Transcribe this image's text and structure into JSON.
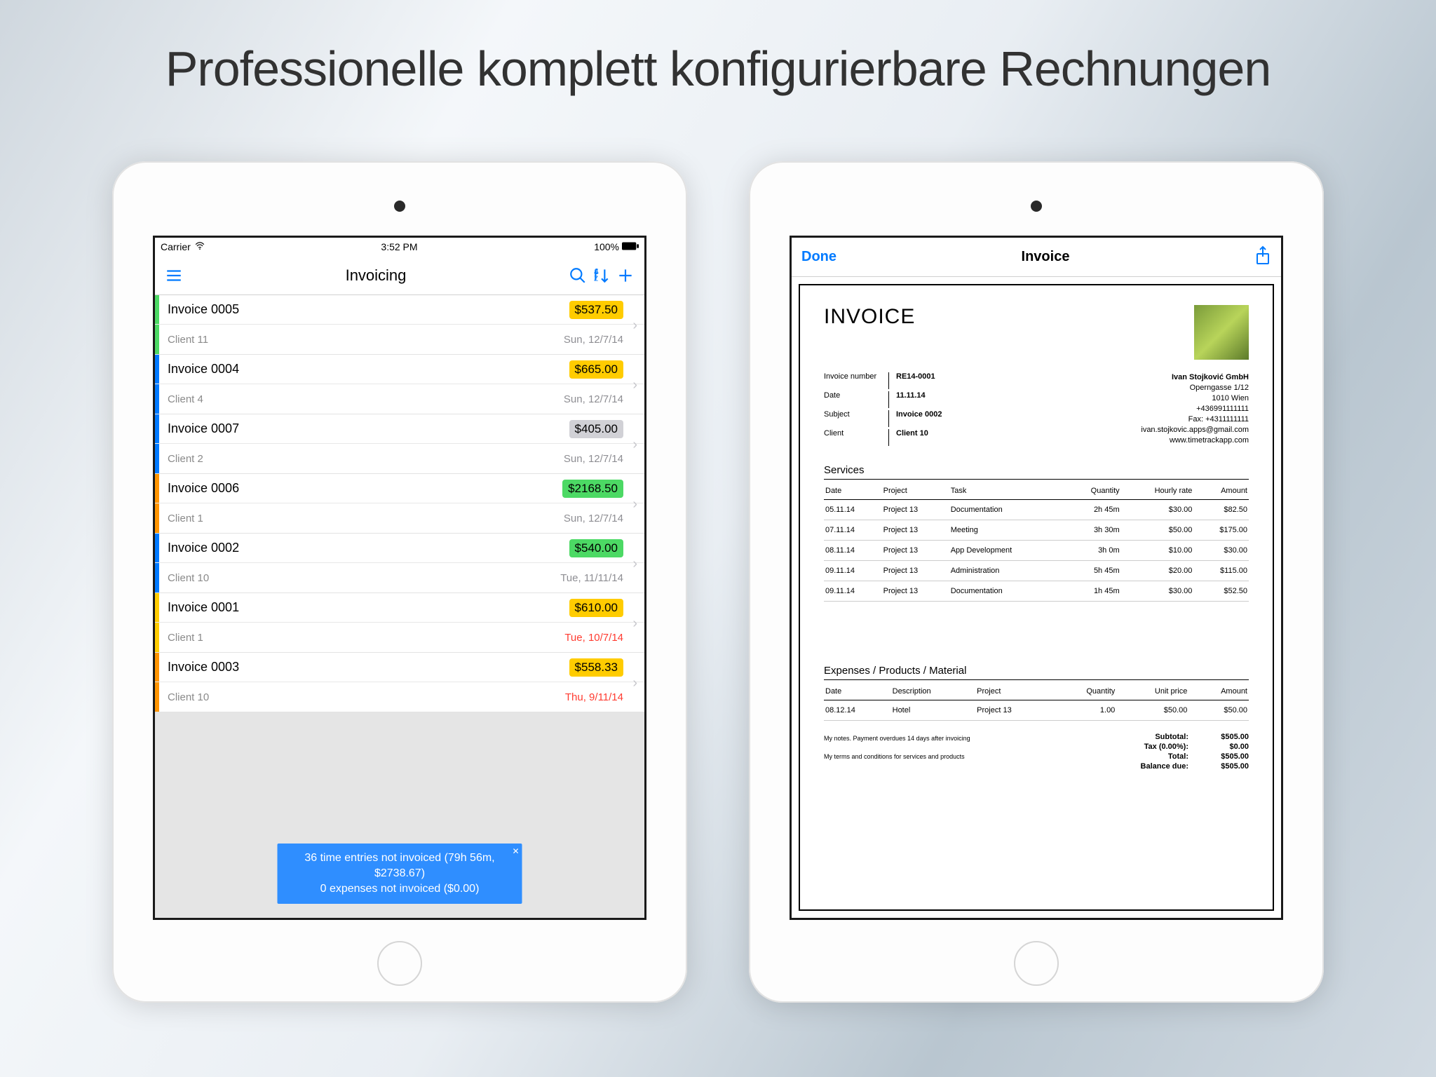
{
  "headline": {
    "part1": "Professionelle",
    "part2": "komplett konfigurierbare",
    "part3": "Rechnungen"
  },
  "statusbar": {
    "carrier": "Carrier",
    "time": "3:52 PM",
    "battery": "100%"
  },
  "leftNav": {
    "title": "Invoicing"
  },
  "colors": {
    "yellow": "#ffcc00",
    "green": "#4cd964",
    "gray": "#d1d1d6",
    "blueBar": "#007aff",
    "orangeBar": "#ff9500",
    "greenBar": "#4cd964",
    "yellowBar": "#ffcc00",
    "redText": "#ff3b30",
    "grayText": "#8e8e93",
    "blackText": "#000"
  },
  "invoices": [
    {
      "id": "Invoice 0005",
      "client": "Client 11",
      "amount": "$537.50",
      "amtbg": "yellow",
      "date": "Sun, 12/7/14",
      "dateColor": "grayText",
      "bar": "greenBar"
    },
    {
      "id": "Invoice 0004",
      "client": "Client 4",
      "amount": "$665.00",
      "amtbg": "yellow",
      "date": "Sun, 12/7/14",
      "dateColor": "grayText",
      "bar": "blueBar"
    },
    {
      "id": "Invoice 0007",
      "client": "Client 2",
      "amount": "$405.00",
      "amtbg": "gray",
      "date": "Sun, 12/7/14",
      "dateColor": "grayText",
      "bar": "blueBar"
    },
    {
      "id": "Invoice 0006",
      "client": "Client 1",
      "amount": "$2168.50",
      "amtbg": "green",
      "date": "Sun, 12/7/14",
      "dateColor": "grayText",
      "bar": "orangeBar"
    },
    {
      "id": "Invoice 0002",
      "client": "Client 10",
      "amount": "$540.00",
      "amtbg": "green",
      "date": "Tue, 11/11/14",
      "dateColor": "grayText",
      "bar": "blueBar"
    },
    {
      "id": "Invoice 0001",
      "client": "Client 1",
      "amount": "$610.00",
      "amtbg": "yellow",
      "date": "Tue, 10/7/14",
      "dateColor": "redText",
      "bar": "yellowBar"
    },
    {
      "id": "Invoice 0003",
      "client": "Client 10",
      "amount": "$558.33",
      "amtbg": "yellow",
      "date": "Thu, 9/11/14",
      "dateColor": "redText",
      "bar": "orangeBar"
    }
  ],
  "toast": {
    "line1": "36 time entries not invoiced (79h 56m, $2738.67)",
    "line2": "0 expenses not invoiced ($0.00)"
  },
  "rightNav": {
    "done": "Done",
    "title": "Invoice"
  },
  "invoice": {
    "heading": "INVOICE",
    "fields": {
      "numberLabel": "Invoice number",
      "number": "RE14-0001",
      "dateLabel": "Date",
      "date": "11.11.14",
      "subjectLabel": "Subject",
      "subject": "Invoice 0002",
      "clientLabel": "Client",
      "client": "Client 10"
    },
    "company": {
      "name": "Ivan Stojković GmbH",
      "addr1": "Operngasse 1/12",
      "addr2": "1010 Wien",
      "phone": "+436991111111",
      "fax": "Fax: +4311111111",
      "email": "ivan.stojkovic.apps@gmail.com",
      "web": "www.timetrackapp.com"
    },
    "servicesTitle": "Services",
    "servicesHead": [
      "Date",
      "Project",
      "Task",
      "Quantity",
      "Hourly rate",
      "Amount"
    ],
    "services": [
      [
        "05.11.14",
        "Project 13",
        "Documentation",
        "2h 45m",
        "$30.00",
        "$82.50"
      ],
      [
        "07.11.14",
        "Project 13",
        "Meeting",
        "3h 30m",
        "$50.00",
        "$175.00"
      ],
      [
        "08.11.14",
        "Project 13",
        "App Development",
        "3h 0m",
        "$10.00",
        "$30.00"
      ],
      [
        "09.11.14",
        "Project 13",
        "Administration",
        "5h 45m",
        "$20.00",
        "$115.00"
      ],
      [
        "09.11.14",
        "Project 13",
        "Documentation",
        "1h 45m",
        "$30.00",
        "$52.50"
      ]
    ],
    "expensesTitle": "Expenses / Products / Material",
    "expensesHead": [
      "Date",
      "Description",
      "Project",
      "Quantity",
      "Unit price",
      "Amount"
    ],
    "expenses": [
      [
        "08.12.14",
        "Hotel",
        "Project 13",
        "1.00",
        "$50.00",
        "$50.00"
      ]
    ],
    "note1": "My notes. Payment overdues 14 days after invoicing",
    "note2": "My terms and conditions for services and products",
    "totals": {
      "subtotalL": "Subtotal:",
      "subtotal": "$505.00",
      "taxL": "Tax (0.00%):",
      "tax": "$0.00",
      "totalL": "Total:",
      "total": "$505.00",
      "balL": "Balance due:",
      "bal": "$505.00"
    }
  }
}
